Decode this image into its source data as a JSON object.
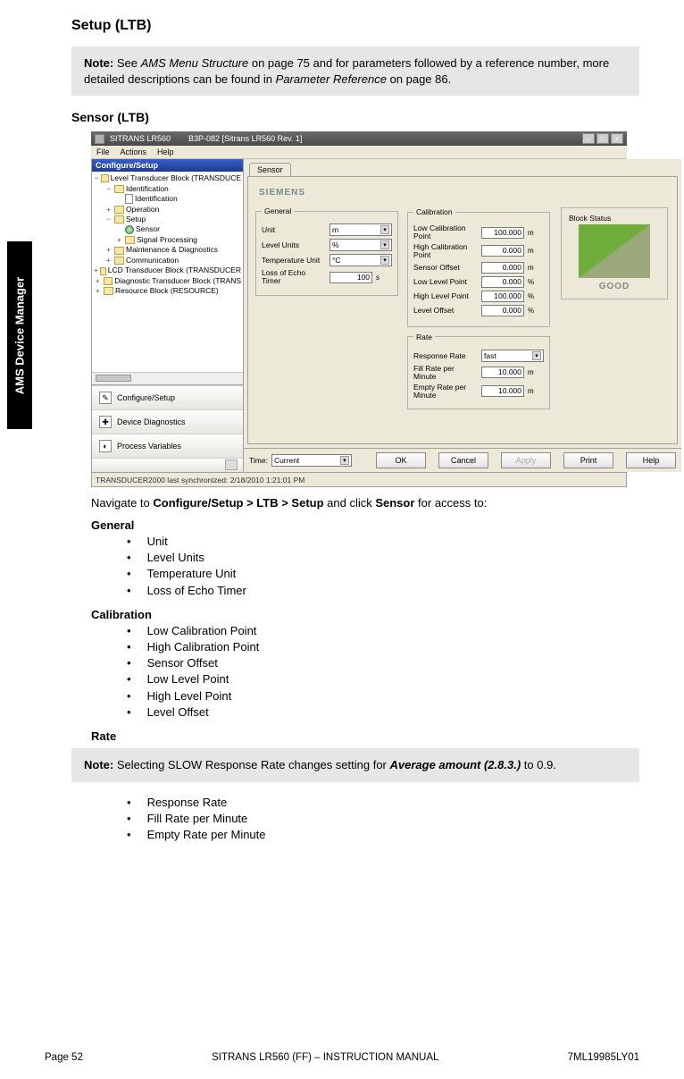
{
  "side_tab": "AMS Device Manager",
  "heading_setup": "Setup (LTB)",
  "note1": {
    "label": "Note:",
    "t1": " See ",
    "link1": "AMS Menu Structure",
    "t2": " on page 75 and for parameters followed by a reference number, more detailed descriptions can be found in ",
    "link2": "Parameter Reference",
    "t3": " on page 86."
  },
  "heading_sensor": "Sensor (LTB)",
  "shot": {
    "title_prefix": "SITRANS LR560",
    "title_mid": "B3P-082 [Sitrans LR560 Rev. 1]",
    "menu": {
      "file": "File",
      "actions": "Actions",
      "help": "Help"
    },
    "tree_header": "Configure/Setup",
    "tree": {
      "r0": "Level Transducer Block (TRANSDUCE",
      "r1": "Identification",
      "r1a": "Identification",
      "r2": "Operation",
      "r3": "Setup",
      "r3a": "Sensor",
      "r3b": "Signal Processing",
      "r4": "Maintenance & Diagnostics",
      "r5": "Communication",
      "r6": "LCD Transducer Block (TRANSDUCER",
      "r7": "Diagnostic Transducer Block (TRANS",
      "r8": "Resource Block (RESOURCE)"
    },
    "navbtns": {
      "cs": "Configure/Setup",
      "dd": "Device Diagnostics",
      "pv": "Process Variables"
    },
    "tab": "Sensor",
    "brand": "SIEMENS",
    "general": {
      "legend": "General",
      "unit_l": "Unit",
      "unit_v": "m",
      "level_l": "Level Units",
      "level_v": "%",
      "temp_l": "Temperature Unit",
      "temp_v": "°C",
      "loss_l": "Loss of Echo Timer",
      "loss_v": "100",
      "loss_u": "s"
    },
    "calib": {
      "legend": "Calibration",
      "low_cal_l": "Low Calibration Point",
      "low_cal_v": "100.000",
      "low_cal_u": "m",
      "high_cal_l": "High Calibration Point",
      "high_cal_v": "0.000",
      "high_cal_u": "m",
      "sensor_off_l": "Sensor Offset",
      "sensor_off_v": "0.000",
      "sensor_off_u": "m",
      "low_lvl_l": "Low Level Point",
      "low_lvl_v": "0.000",
      "low_lvl_u": "%",
      "high_lvl_l": "High Level Point",
      "high_lvl_v": "100.000",
      "high_lvl_u": "%",
      "lvl_off_l": "Level Offset",
      "lvl_off_v": "0.000",
      "lvl_off_u": "%"
    },
    "rate": {
      "legend": "Rate",
      "resp_l": "Response Rate",
      "resp_v": "fast",
      "fill_l": "Fill Rate per Minute",
      "fill_v": "10.000",
      "fill_u": "m",
      "empty_l": "Empty Rate per Minute",
      "empty_v": "10.000",
      "empty_u": "m"
    },
    "block_status": {
      "label": "Block Status",
      "val": "GOOD"
    },
    "time_l": "Time:",
    "time_v": "Current",
    "buttons": {
      "ok": "OK",
      "cancel": "Cancel",
      "apply": "Apply",
      "print": "Print",
      "help": "Help"
    },
    "status": "TRANSDUCER2000 last synchronized: 2/18/2010 1:21:01 PM"
  },
  "nav": {
    "intro1": "Navigate to ",
    "path": "Configure/Setup > LTB > Setup",
    "intro2": " and click ",
    "item": "Sensor",
    "intro3": " for access to:"
  },
  "cat_general": "General",
  "general_items": {
    "i0": "Unit",
    "i1": "Level Units",
    "i2": "Temperature Unit",
    "i3": "Loss of Echo Timer"
  },
  "cat_calib": "Calibration",
  "calib_items": {
    "i0": "Low Calibration Point",
    "i1": "High Calibration Point",
    "i2": "Sensor Offset",
    "i3": "Low Level Point",
    "i4": "High Level Point",
    "i5": "Level Offset"
  },
  "cat_rate": "Rate",
  "note2": {
    "label": "Note:",
    "t1": " Selecting SLOW Response Rate changes setting for ",
    "link": "Average amount (2.8.3.)",
    "t2": " to 0.9."
  },
  "rate_items": {
    "i0": "Response Rate",
    "i1": "Fill Rate per Minute",
    "i2": "Empty Rate per Minute"
  },
  "footer": {
    "left": "Page 52",
    "center": "SITRANS LR560 (FF) – INSTRUCTION MANUAL",
    "right": "7ML19985LY01"
  }
}
